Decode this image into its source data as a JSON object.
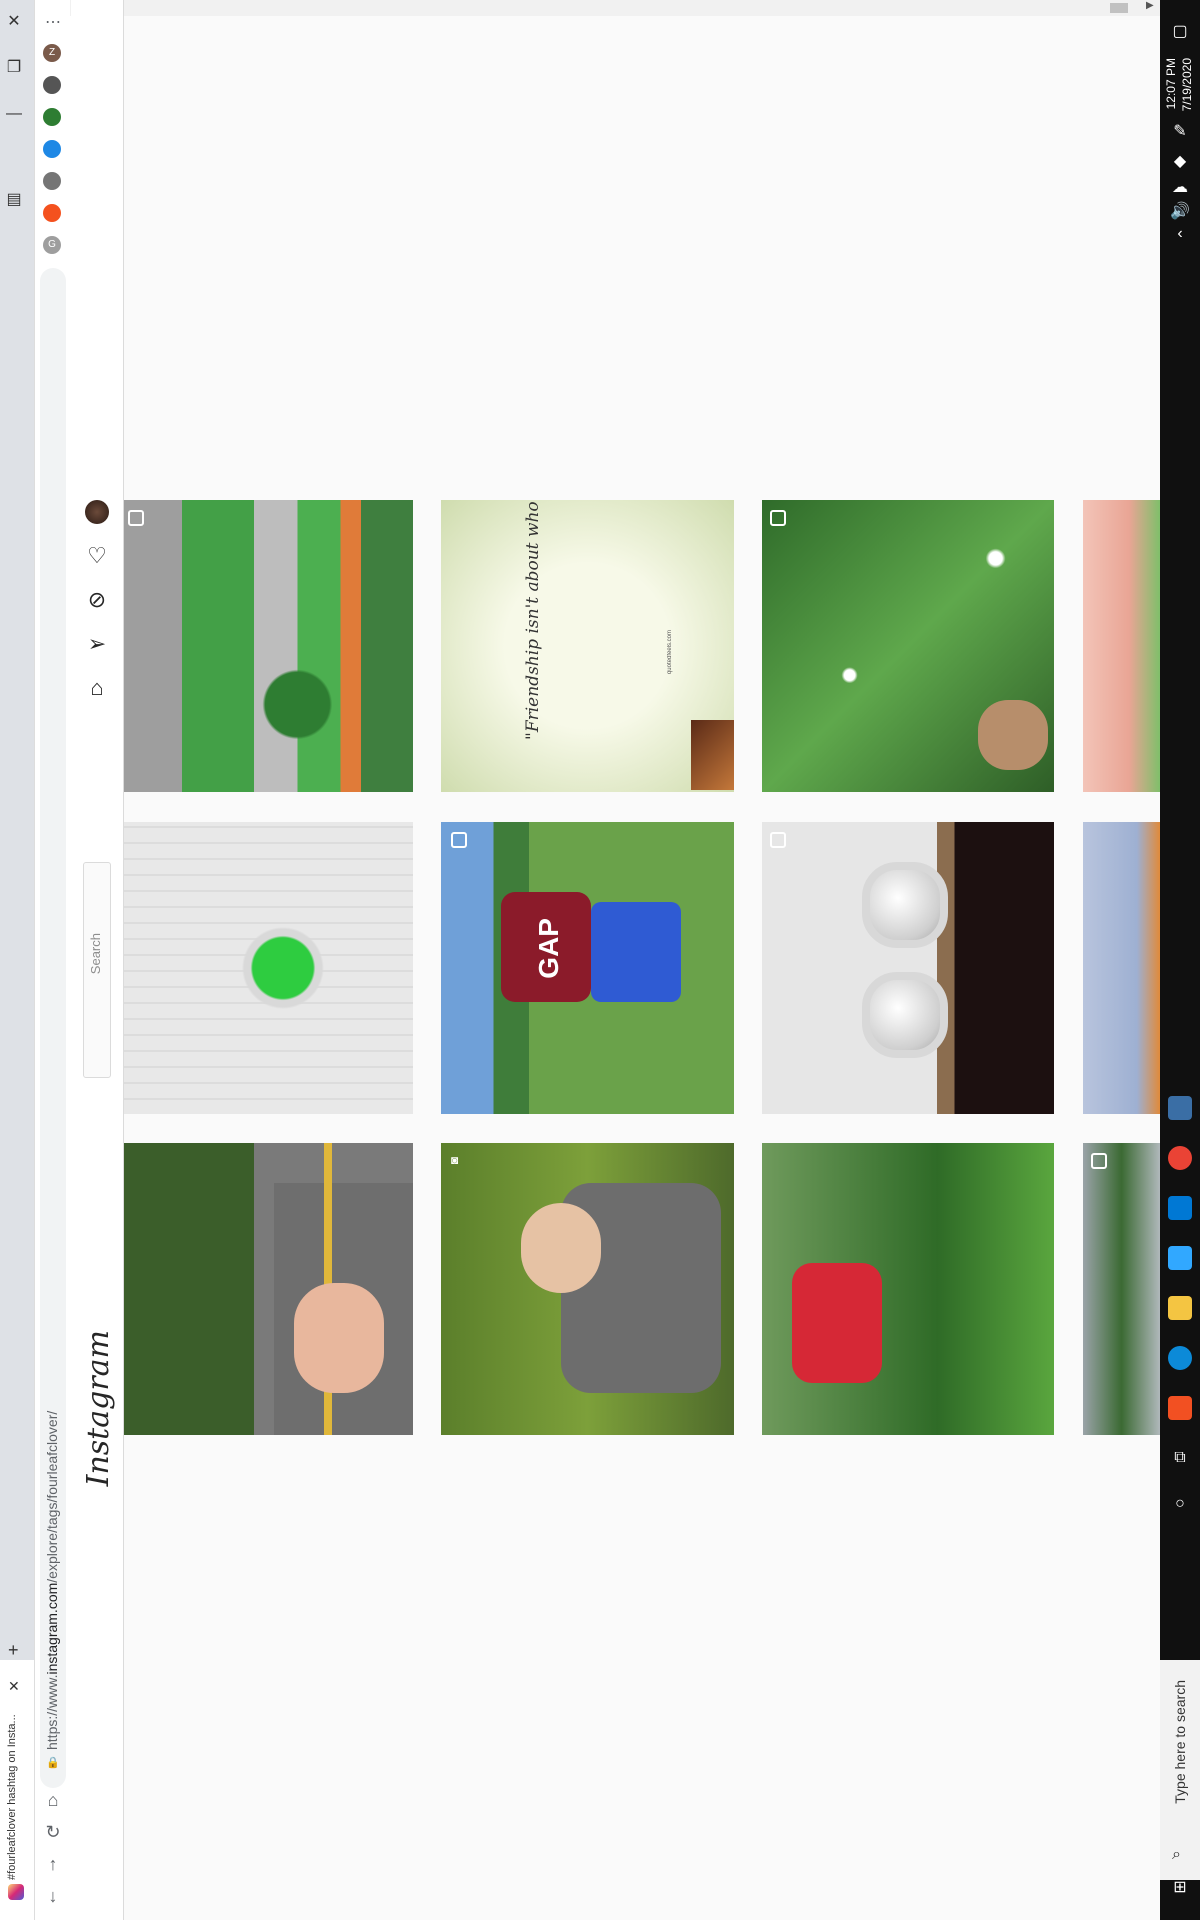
{
  "browser": {
    "tab_title": "#fourleafclover hashtag on Insta...",
    "url_prefix": "https://www.",
    "url_domain": "instagram.com",
    "url_path": "/explore/tags/fourleafclover/",
    "window_controls": [
      "close",
      "restore",
      "minimize"
    ],
    "extensions": [
      {
        "letter": "Z",
        "color": "#7a5a4a"
      },
      {
        "letter": "",
        "color": "#555555"
      },
      {
        "letter": "",
        "color": "#2e7d32"
      },
      {
        "letter": "",
        "color": "#1e88e5"
      },
      {
        "letter": "",
        "color": "#757575"
      },
      {
        "letter": "",
        "color": "#f4511e"
      },
      {
        "letter": "G",
        "color": "#9e9e9e"
      }
    ]
  },
  "instagram": {
    "logo": "Instagram",
    "search_placeholder": "Search",
    "nav_icons": [
      "home-icon",
      "direct-icon",
      "explore-icon",
      "activity-icon",
      "profile-avatar"
    ]
  },
  "posts": [
    {
      "id": "p1",
      "desc": "four leaf clover held on path"
    },
    {
      "id": "p2",
      "quote": "\"Friendship isn't about who you've known the longest. It's about who walked into your life, said \"I'm here for you\", and proved it.\"",
      "credit": "quotedfeels.com"
    },
    {
      "id": "p3",
      "desc": "clover field with sneaker"
    },
    {
      "id": "p4",
      "desc": "hand holding clover"
    },
    {
      "id": "p5",
      "desc": "four leaf clover pendant"
    },
    {
      "id": "p6",
      "desc": "two kids in field",
      "shirt_text": "GAP"
    },
    {
      "id": "p7",
      "desc": "pearl earrings"
    },
    {
      "id": "p8",
      "desc": "embroidered fabric"
    },
    {
      "id": "p9",
      "desc": "clover near road"
    },
    {
      "id": "p10",
      "desc": "woman holding clover"
    },
    {
      "id": "p11",
      "desc": "child in red jacket in grass"
    },
    {
      "id": "p12",
      "desc": "clover in jar"
    }
  ],
  "taskbar": {
    "time": "12:07 PM",
    "date": "7/19/2020",
    "search_placeholder": "Type here to search",
    "colors": {
      "chrome": "#ea4335",
      "outlook": "#0078d4",
      "photoshop": "#31a8ff",
      "explorer": "#f4c542",
      "edge": "#0c8ad8",
      "store": "#f25022"
    }
  }
}
